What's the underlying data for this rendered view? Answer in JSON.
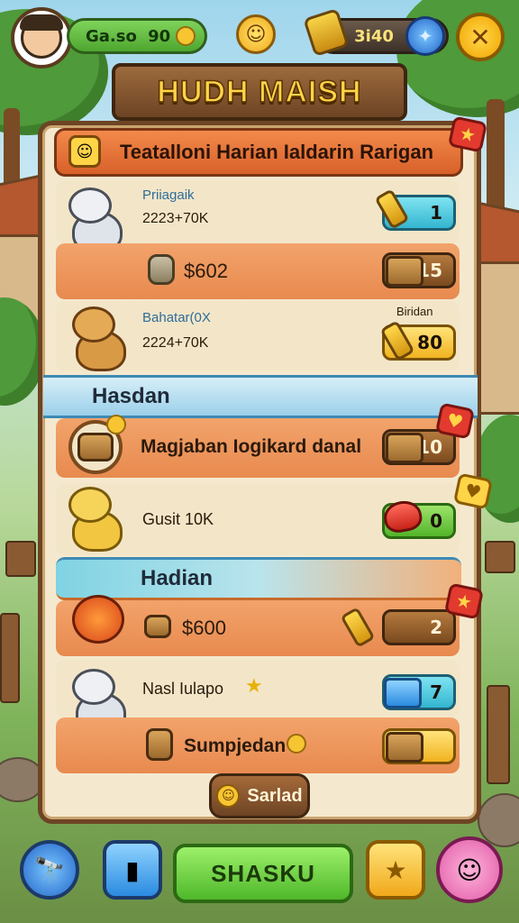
{
  "hud": {
    "currency_left": "Ga.so",
    "currency_right": "90",
    "resource_value": "3i40"
  },
  "title": "HUDH MAISH",
  "banner": {
    "text": "Teatalloni Harian Ialdarin Rarigan"
  },
  "rows": [
    {
      "name": "Priiagaik",
      "stat": "2223+70K",
      "chip": "1"
    },
    {
      "stat": "$602",
      "chip": "15"
    },
    {
      "tag": "Biridan",
      "name": "Bahatar(0X",
      "stat": "2224+70K",
      "chip": "80"
    }
  ],
  "section1": {
    "title": "Hasdan",
    "item_text": "Magjaban Iogikard danal",
    "item_chip": "10"
  },
  "row_gold": {
    "text": "Gusit 10K",
    "chip": "0"
  },
  "section2": {
    "title": "Hadian",
    "item_text": "$600",
    "item_chip": "2"
  },
  "row_cat": {
    "text": "Nasl Iulapo",
    "chip": "7"
  },
  "row_sump": {
    "text": "Sumpjedan",
    "chip": ""
  },
  "saved_button": "Sarlad",
  "bottom": {
    "main_button": "SHASKU"
  },
  "colors": {
    "panel": "#f4e9cf",
    "banner": "#e8783b",
    "accent_green": "#4fb82a",
    "accent_gold": "#f6c531"
  }
}
